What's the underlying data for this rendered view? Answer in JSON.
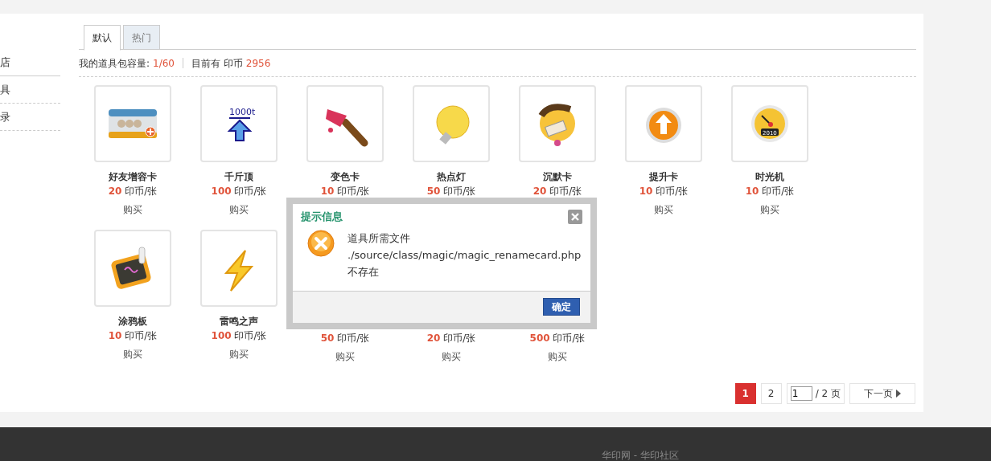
{
  "sidebar": {
    "items": [
      {
        "label": "店"
      },
      {
        "label": "具"
      },
      {
        "label": "录"
      }
    ]
  },
  "tabs": [
    {
      "label": "默认",
      "selected": true
    },
    {
      "label": "热门",
      "selected": false
    }
  ],
  "summary": {
    "capacity_label": "我的道具包容量:",
    "capacity": "1/60",
    "coins_label": "目前有 印币",
    "coins": "2956"
  },
  "items": [
    {
      "name": "好友增容卡",
      "price": "20",
      "unit": "印币/张",
      "buy": "购买"
    },
    {
      "name": "千斤顶",
      "icon_text": "1000t",
      "price": "100",
      "unit": "印币/张",
      "buy": "购买"
    },
    {
      "name": "变色卡",
      "price": "10",
      "unit": "印币/张"
    },
    {
      "name": "热点灯",
      "price": "50",
      "unit": "印币/张"
    },
    {
      "name": "沉默卡",
      "price": "20",
      "unit": "印币/张"
    },
    {
      "name": "提升卡",
      "price": "10",
      "unit": "印币/张",
      "buy": "购买"
    },
    {
      "name": "时光机",
      "icon_text": "2010",
      "price": "10",
      "unit": "印币/张",
      "buy": "购买"
    },
    {
      "name": "涂鸦板",
      "price": "10",
      "unit": "印币/张",
      "buy": "购买"
    },
    {
      "name": "雷鸣之声",
      "price": "100",
      "unit": "印币/张",
      "buy": "购买"
    },
    {
      "price": "50",
      "unit": "印币/张",
      "buy": "购买"
    },
    {
      "price": "20",
      "unit": "印币/张",
      "buy": "购买"
    },
    {
      "price": "500",
      "unit": "印币/张",
      "buy": "购买"
    }
  ],
  "pagination": {
    "pages": [
      {
        "label": "1",
        "selected": true
      },
      {
        "label": "2",
        "selected": false
      }
    ],
    "page_input": "1",
    "total": "/ 2 页",
    "next": "下一页"
  },
  "dialog": {
    "title": "提示信息",
    "message": "道具所需文件 ./source/class/magic/magic_renamecard.php 不存在",
    "ok": "确定"
  },
  "footer": {
    "links": "华印网 - 华印社区"
  }
}
